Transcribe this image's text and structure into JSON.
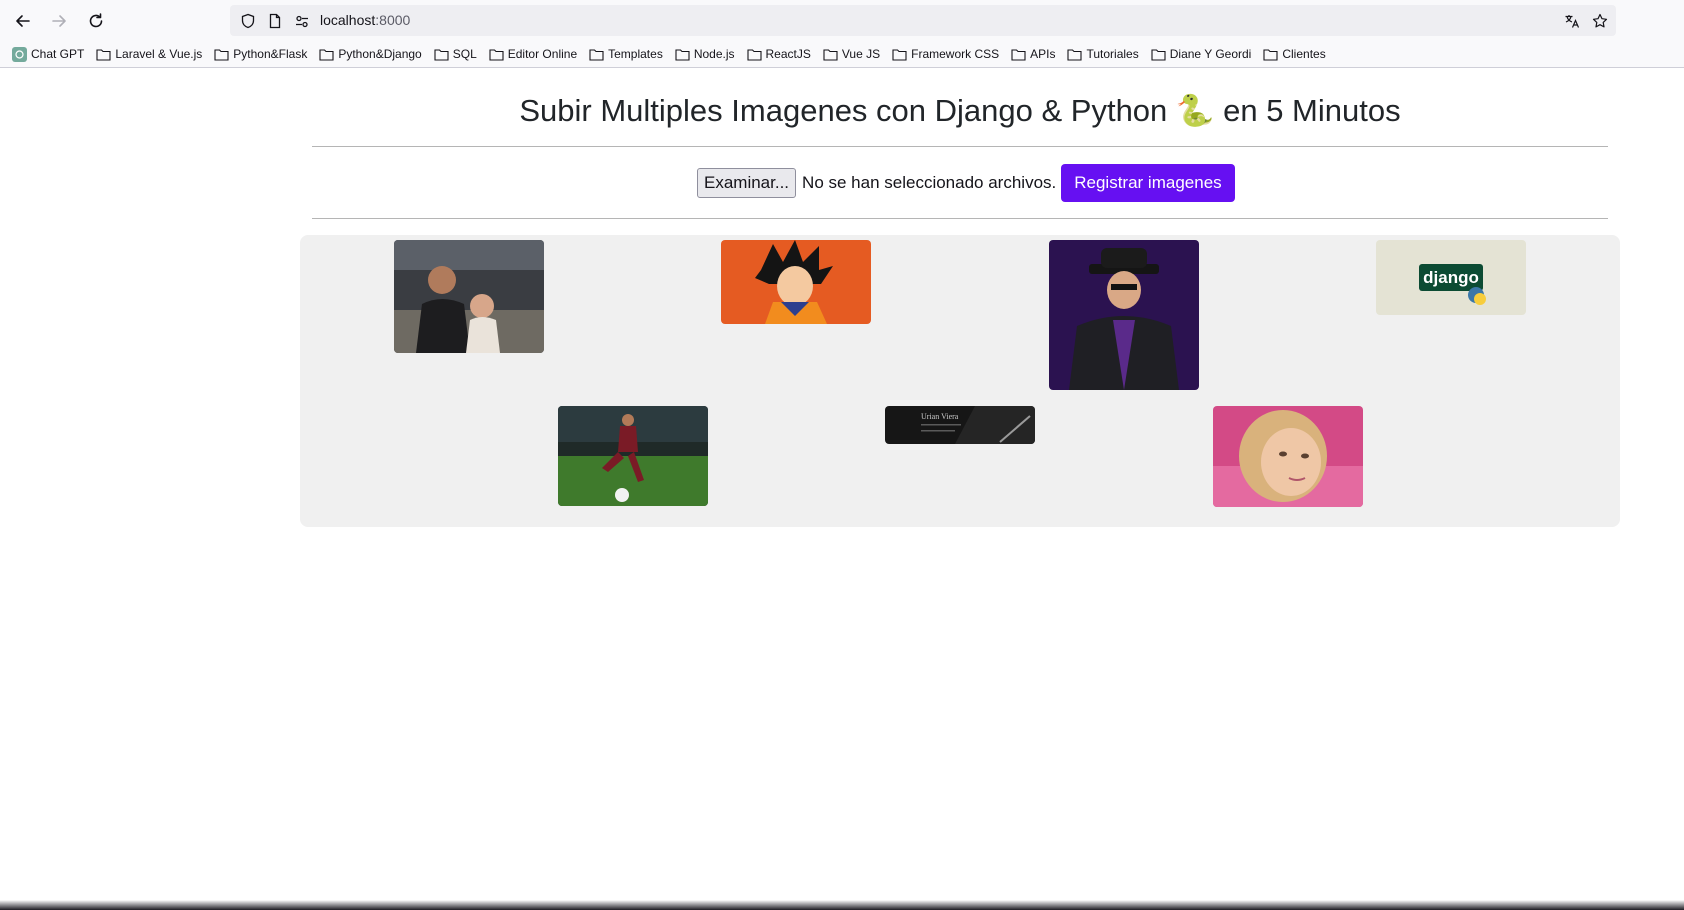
{
  "browser": {
    "url_host": "localhost",
    "url_port": ":8000",
    "bookmarks": [
      {
        "label": "Chat GPT",
        "icon": "chatgpt-icon"
      },
      {
        "label": "Laravel & Vue.js",
        "icon": "folder-icon"
      },
      {
        "label": "Python&Flask",
        "icon": "folder-icon"
      },
      {
        "label": "Python&Django",
        "icon": "folder-icon"
      },
      {
        "label": "SQL",
        "icon": "folder-icon"
      },
      {
        "label": "Editor Online",
        "icon": "folder-icon"
      },
      {
        "label": "Templates",
        "icon": "folder-icon"
      },
      {
        "label": "Node.js",
        "icon": "folder-icon"
      },
      {
        "label": "ReactJS",
        "icon": "folder-icon"
      },
      {
        "label": "Vue JS",
        "icon": "folder-icon"
      },
      {
        "label": "Framework CSS",
        "icon": "folder-icon"
      },
      {
        "label": "APIs",
        "icon": "folder-icon"
      },
      {
        "label": "Tutoriales",
        "icon": "folder-icon"
      },
      {
        "label": "Diane Y Geordi",
        "icon": "folder-icon"
      },
      {
        "label": "Clientes",
        "icon": "folder-icon"
      }
    ]
  },
  "page": {
    "title": "Subir Multiples Imagenes con Django & Python 🐍 en 5 Minutos",
    "upload": {
      "browse_label": "Examinar...",
      "status_text": "No se han seleccionado archivos.",
      "submit_label": "Registrar imagenes"
    }
  },
  "gallery": {
    "images": [
      {
        "subject": "man-with-baby-photo"
      },
      {
        "subject": "goku-cartoon-image"
      },
      {
        "subject": "man-in-fedora-photo"
      },
      {
        "subject": "django-python-logo",
        "logo_text": "django"
      },
      {
        "subject": "soccer-player-photo"
      },
      {
        "subject": "urian-viera-card-image",
        "logo_text": "Urian Viera"
      },
      {
        "subject": "woman-selfie-photo"
      }
    ]
  },
  "colors": {
    "accent_button": "#6610f2",
    "gallery_bg": "#f0f0f0"
  }
}
